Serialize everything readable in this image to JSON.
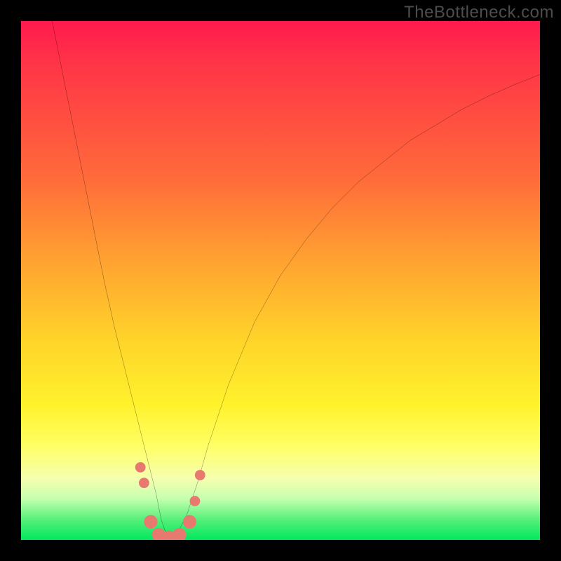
{
  "watermark": "TheBottleneck.com",
  "colors": {
    "frame": "#000000",
    "curve": "#000000",
    "dot": "#e8796f"
  },
  "chart_data": {
    "type": "line",
    "title": "",
    "xlabel": "",
    "ylabel": "",
    "xlim": [
      0,
      100
    ],
    "ylim": [
      0,
      100
    ],
    "grid": false,
    "series": [
      {
        "name": "bottleneck-curve",
        "x": [
          6,
          8,
          10,
          12,
          14,
          16,
          18,
          20,
          22,
          24,
          26,
          27,
          28,
          29,
          30,
          32,
          34,
          36,
          40,
          45,
          50,
          55,
          60,
          65,
          70,
          75,
          80,
          85,
          90,
          95,
          100
        ],
        "y": [
          100,
          90,
          80,
          70,
          60,
          50,
          41,
          33,
          25,
          17,
          9,
          4,
          1,
          0,
          1,
          5,
          11,
          18,
          30,
          42,
          51,
          58,
          64,
          69,
          73,
          77,
          80,
          83,
          85.5,
          87.7,
          89.7
        ]
      }
    ],
    "markers": [
      {
        "x": 23.0,
        "y": 14.0,
        "r": 1.0
      },
      {
        "x": 23.7,
        "y": 11.0,
        "r": 1.0
      },
      {
        "x": 25.0,
        "y": 3.5,
        "r": 1.3
      },
      {
        "x": 26.5,
        "y": 1.0,
        "r": 1.3
      },
      {
        "x": 28.5,
        "y": 0.5,
        "r": 1.3
      },
      {
        "x": 30.5,
        "y": 1.0,
        "r": 1.3
      },
      {
        "x": 32.5,
        "y": 3.5,
        "r": 1.3
      },
      {
        "x": 33.5,
        "y": 7.5,
        "r": 1.0
      },
      {
        "x": 34.5,
        "y": 12.5,
        "r": 1.0
      }
    ],
    "background_gradient": {
      "type": "vertical",
      "stops": [
        {
          "pct": 0,
          "color": "#ff1a4d"
        },
        {
          "pct": 30,
          "color": "#ff6a3a"
        },
        {
          "pct": 62,
          "color": "#ffd52a"
        },
        {
          "pct": 82,
          "color": "#ffff66"
        },
        {
          "pct": 96,
          "color": "#58f07a"
        },
        {
          "pct": 100,
          "color": "#00e85e"
        }
      ]
    }
  }
}
